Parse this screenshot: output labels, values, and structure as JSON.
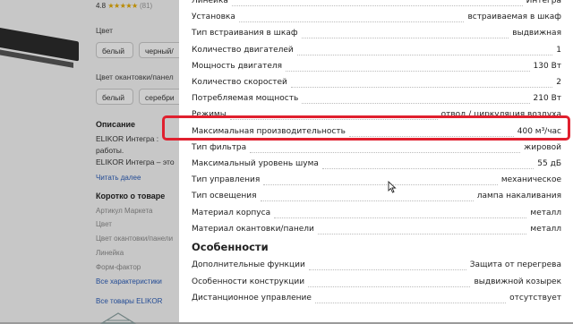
{
  "background_page": {
    "rating": {
      "value": "4.8",
      "stars": "★★★★★",
      "count": "(81)"
    },
    "color_label": "Цвет",
    "color_options": [
      "белый",
      "черный/"
    ],
    "trim_color_label": "Цвет окантовки/панел",
    "trim_options": [
      "белый",
      "серебри"
    ],
    "description_heading": "Описание",
    "description_lines": [
      "ELIKOR Интегра :",
      "работы.",
      "ELIKOR Интегра – это"
    ],
    "read_more": "Читать далее",
    "about_heading": "Коротко о товаре",
    "about_items": [
      "Артикул Маркета",
      "Цвет",
      "Цвет окантовки/панели",
      "Линейка",
      "Форм-фактор"
    ],
    "all_specs_link": "Все характеристики",
    "all_products_link": "Все товары ELIKOR"
  },
  "specs": [
    {
      "name": "Линейка",
      "value": "Интегра"
    },
    {
      "name": "Установка",
      "value": "встраиваемая в шкаф"
    },
    {
      "name": "Тип встраивания в шкаф",
      "value": "выдвижная"
    },
    {
      "name": "Количество двигателей",
      "value": "1"
    },
    {
      "name": "Мощность двигателя",
      "value": "130 Вт"
    },
    {
      "name": "Количество скоростей",
      "value": "2"
    },
    {
      "name": "Потребляемая мощность",
      "value": "210 Вт"
    },
    {
      "name": "Режимы",
      "value": "отвод / циркуляция воздуха"
    },
    {
      "name": "Максимальная производительность",
      "value": "400 м³/час"
    },
    {
      "name": "Тип фильтра",
      "value": "жировой"
    },
    {
      "name": "Максимальный уровень шума",
      "value": "55 дБ"
    },
    {
      "name": "Тип управления",
      "value": "механическое"
    },
    {
      "name": "Тип освещения",
      "value": "лампа накаливания"
    },
    {
      "name": "Материал корпуса",
      "value": "металл"
    },
    {
      "name": "Материал окантовки/панели",
      "value": "металл"
    }
  ],
  "features_title": "Особенности",
  "features": [
    {
      "name": "Дополнительные функции",
      "value": "Защита от перегрева"
    },
    {
      "name": "Особенности конструкции",
      "value": "выдвижной козырек"
    },
    {
      "name": "Дистанционное управление",
      "value": "отсутствует"
    }
  ],
  "colors": {
    "highlight": "#e0202e",
    "link": "#2a5bb5",
    "star": "#e2a800"
  },
  "icons": {
    "cursor": "mouse-pointer-icon"
  }
}
